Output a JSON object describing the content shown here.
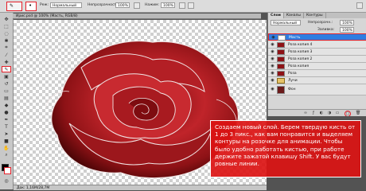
{
  "options_bar": {
    "mode_label": "Реж:",
    "mode_value": "Нормальный",
    "opacity_label": "Непрозрачность:",
    "opacity_value": "100%",
    "flow_label": "Нажим:",
    "flow_value": "100%"
  },
  "document": {
    "tab_title": "Ирис.psd @ 100% (Масть, RGB/8)",
    "status_text": "Док: 1,16M/28,7M"
  },
  "toolbox": {
    "tools": [
      "move-tool",
      "marquee-tool",
      "lasso-tool",
      "quick-select-tool",
      "crop-tool",
      "eyedropper-tool",
      "healing-tool",
      "brush-tool",
      "stamp-tool",
      "history-brush-tool",
      "eraser-tool",
      "gradient-tool",
      "blur-tool",
      "dodge-tool",
      "pen-tool",
      "type-tool",
      "path-select-tool",
      "shape-tool",
      "hand-tool",
      "zoom-tool"
    ],
    "selected_tool": "brush-tool",
    "foreground_color": "#ffffff",
    "background_color": "#000000"
  },
  "layers_panel": {
    "tabs": [
      "Слои",
      "Каналы",
      "Контуры"
    ],
    "active_tab": "Слои",
    "mode_value": "Нормальный",
    "opacity_label": "Непрозрачн.:",
    "opacity_value": "100%",
    "fill_label": "Заливка:",
    "fill_value": "100%",
    "layers": [
      {
        "name": "Масть",
        "active": true
      },
      {
        "name": "Роза копия 4",
        "active": false
      },
      {
        "name": "Роза копия 3",
        "active": false
      },
      {
        "name": "Роза копия 2",
        "active": false
      },
      {
        "name": "Роза копия",
        "active": false
      },
      {
        "name": "Роза",
        "active": false
      },
      {
        "name": "Лучи",
        "active": false
      },
      {
        "name": "Фон",
        "active": false
      }
    ]
  },
  "caption": {
    "text": "Создаем новый слой. Берем твердую кисть от 1 до 3 пикс., как вам понравится и выделяем контуры на розочке для анимации. Чтобы было удобно работать кистью, при работе держите зажатой клавишу Shift. У вас будут ровные линии."
  },
  "colors": {
    "highlight": "#e5202a",
    "caption_bg": "#dc1414",
    "active_layer": "#2e7de1"
  }
}
